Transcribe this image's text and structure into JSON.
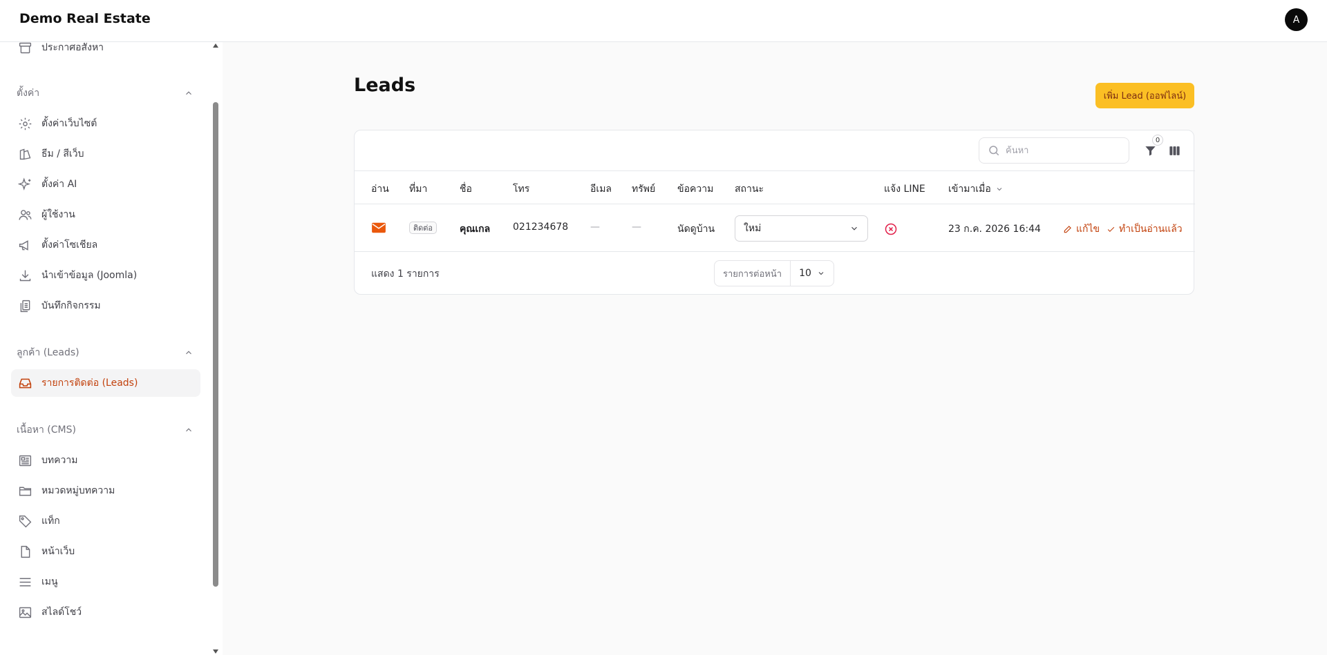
{
  "app": {
    "brand": "Demo Real Estate",
    "user_initial": "A"
  },
  "sidebar": {
    "top_cut_item": "ประกาศอสังหา",
    "groups": [
      {
        "label": "ตั้งค่า",
        "items": [
          "ตั้งค่าเว็บไซต์",
          "ธีม / สีเว็บ",
          "ตั้งค่า AI",
          "ผู้ใช้งาน",
          "ตั้งค่าโซเชียล",
          "นำเข้าข้อมูล (Joomla)",
          "บันทึกกิจกรรม"
        ]
      },
      {
        "label": "ลูกค้า (Leads)",
        "items": [
          "รายการติดต่อ (Leads)"
        ]
      },
      {
        "label": "เนื้อหา (CMS)",
        "items": [
          "บทความ",
          "หมวดหมู่บทความ",
          "แท็ก",
          "หน้าเว็บ",
          "เมนู",
          "สไลด์โชว์"
        ]
      }
    ],
    "active_item": "รายการติดต่อ (Leads)"
  },
  "main": {
    "title": "Leads",
    "add_button": "เพิ่ม Lead (ออฟไลน์)",
    "search_placeholder": "ค้นหา",
    "filter_count": "0",
    "columns": [
      "อ่าน",
      "ที่มา",
      "ชื่อ",
      "โทร",
      "อีเมล",
      "ทรัพย์",
      "ข้อความ",
      "สถานะ",
      "แจ้ง LINE",
      "เข้ามาเมื่อ"
    ],
    "rows": [
      {
        "source": "ติดต่อ",
        "name": "คุณเกล",
        "phone": "021234678",
        "email": "—",
        "property": "—",
        "message": "นัดดูบ้าน",
        "status": "ใหม่",
        "created": "23 ก.ค. 2026 16:44",
        "edit_label": "แก้ไข",
        "mark_read_label": "ทำเป็นอ่านแล้ว"
      }
    ],
    "footer": {
      "showing": "แสดง 1 รายการ",
      "per_page_label": "รายการต่อหน้า",
      "per_page_value": "10"
    }
  },
  "colors": {
    "accent": "#c2410c",
    "button_bg": "#fbbf24",
    "mail_icon": "#ea580c",
    "line_off": "#e11d48"
  }
}
